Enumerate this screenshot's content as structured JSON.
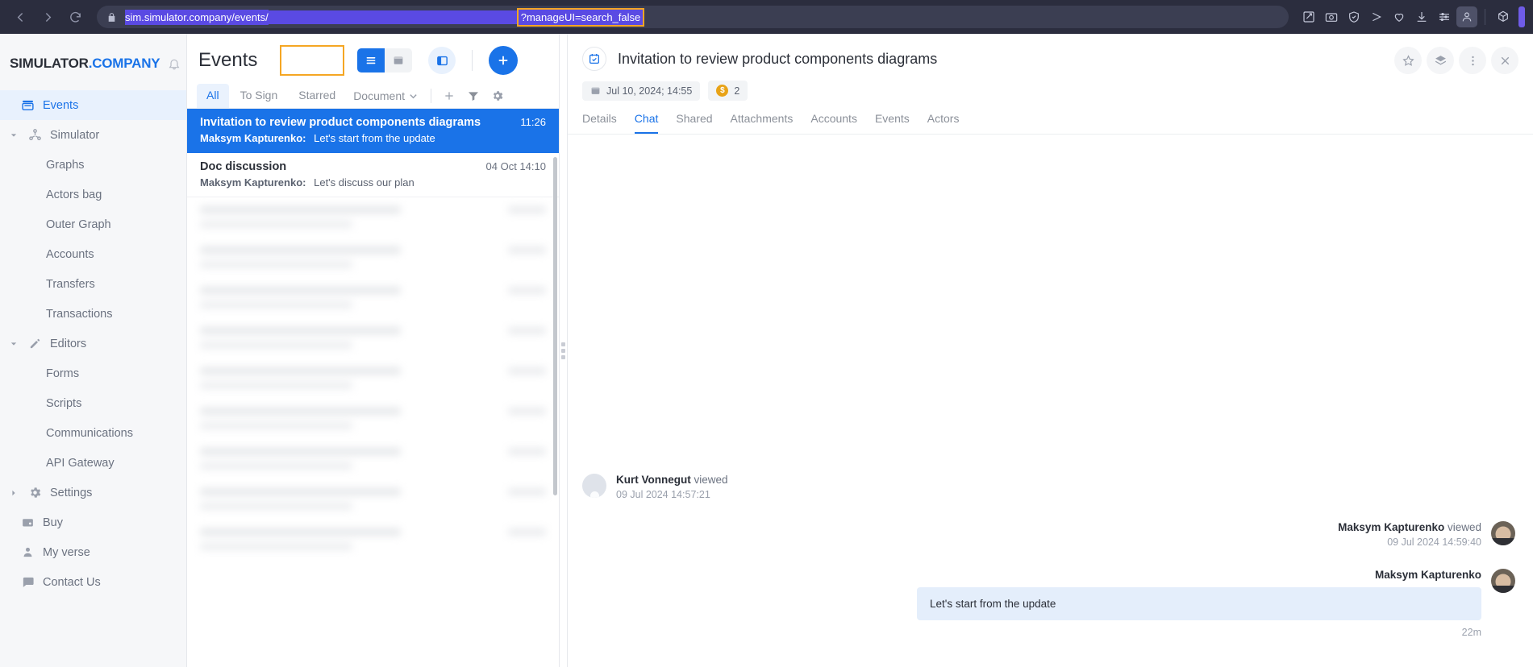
{
  "browser": {
    "nav": {
      "back": "back-arrow",
      "forward": "forward-arrow",
      "reload": "reload-icon"
    },
    "url": {
      "lock": "lock-icon",
      "domain": "sim.simulator.company/events/",
      "param_highlighted": "?manageUI=search_false"
    },
    "toolbar_icons": [
      "edit-icon",
      "camera-icon",
      "shield-icon",
      "send-icon",
      "heart-icon",
      "download-icon",
      "sliders-icon",
      "profile-icon",
      "cube-icon"
    ]
  },
  "sidebar": {
    "brand": {
      "primary": "SIMULATOR",
      "accent": ".COMPANY"
    },
    "items": [
      {
        "label": "Events",
        "icon": "events-icon",
        "active": true,
        "level": 0,
        "expandable": false
      },
      {
        "label": "Simulator",
        "icon": "simulator-icon",
        "active": false,
        "level": 0,
        "expandable": true,
        "expanded": true
      },
      {
        "label": "Graphs",
        "level": 1
      },
      {
        "label": "Actors bag",
        "level": 1
      },
      {
        "label": "Outer Graph",
        "level": 1
      },
      {
        "label": "Accounts",
        "level": 1
      },
      {
        "label": "Transfers",
        "level": 1
      },
      {
        "label": "Transactions",
        "level": 1
      },
      {
        "label": "Editors",
        "icon": "pencil-icon",
        "active": false,
        "level": 0,
        "expandable": true,
        "expanded": true
      },
      {
        "label": "Forms",
        "level": 1
      },
      {
        "label": "Scripts",
        "level": 1
      },
      {
        "label": "Communications",
        "level": 1
      },
      {
        "label": "API Gateway",
        "level": 1
      },
      {
        "label": "Settings",
        "icon": "gear-icon",
        "active": false,
        "level": 0,
        "expandable": true,
        "expanded": false
      },
      {
        "label": "Buy",
        "icon": "buy-icon",
        "active": false,
        "level": 0,
        "expandable": false
      },
      {
        "label": "My verse",
        "icon": "user-icon",
        "active": false,
        "level": 0,
        "expandable": false
      },
      {
        "label": "Contact Us",
        "icon": "chat-bubble-icon",
        "active": false,
        "level": 0,
        "expandable": false
      }
    ]
  },
  "events_panel": {
    "title": "Events",
    "search_placeholder": "",
    "search_value": "",
    "view_buttons": [
      "list-view-icon",
      "calendar-view-icon"
    ],
    "split_toggle": "split-pane-icon",
    "add_button": "plus-icon",
    "tabs": [
      {
        "label": "All",
        "active": true
      },
      {
        "label": "To Sign",
        "active": false
      },
      {
        "label": "Starred",
        "active": false
      }
    ],
    "dropdown": {
      "label": "Document",
      "icon": "chevron-down-icon"
    },
    "tool_icons": [
      "plus-icon",
      "filter-icon",
      "gear-icon"
    ],
    "rows": [
      {
        "subject": "Invitation to review product components diagrams",
        "time": "11:26",
        "from": "Maksym Kapturenko:",
        "preview": "Let's start from the update",
        "selected": true
      },
      {
        "subject": "Doc discussion",
        "time": "04 Oct 14:10",
        "from": "Maksym Kapturenko:",
        "preview": "Let's discuss our plan",
        "selected": false
      }
    ]
  },
  "detail": {
    "icon": "calendar-check-icon",
    "title": "Invitation to review product components diagrams",
    "date_badge": "Jul 10, 2024; 14:55",
    "coin_badge": "2",
    "actions": [
      "star-icon",
      "layers-icon",
      "more-vertical-icon",
      "close-icon"
    ],
    "tabs": [
      {
        "label": "Details",
        "active": false
      },
      {
        "label": "Chat",
        "active": true
      },
      {
        "label": "Shared",
        "active": false
      },
      {
        "label": "Attachments",
        "active": false
      },
      {
        "label": "Accounts",
        "active": false
      },
      {
        "label": "Events",
        "active": false
      },
      {
        "label": "Actors",
        "active": false
      }
    ],
    "messages": [
      {
        "side": "left",
        "name": "Kurt Vonnegut",
        "action": "viewed",
        "timestamp": "09 Jul 2024 14:57:21",
        "avatar": "placeholder"
      },
      {
        "side": "right",
        "name": "Maksym Kapturenko",
        "action": "viewed",
        "timestamp": "09 Jul 2024 14:59:40",
        "avatar": "photo"
      },
      {
        "side": "right",
        "name": "Maksym Kapturenko",
        "action": "",
        "body": "Let's start from the update",
        "timestamp": "22m",
        "avatar": "photo"
      }
    ]
  },
  "colors": {
    "accent": "#1a73e8",
    "annotation": "#f5a623",
    "browser_bg": "#2b2d3e",
    "url_select": "#5a4ae3",
    "coin": "#e8a317"
  }
}
